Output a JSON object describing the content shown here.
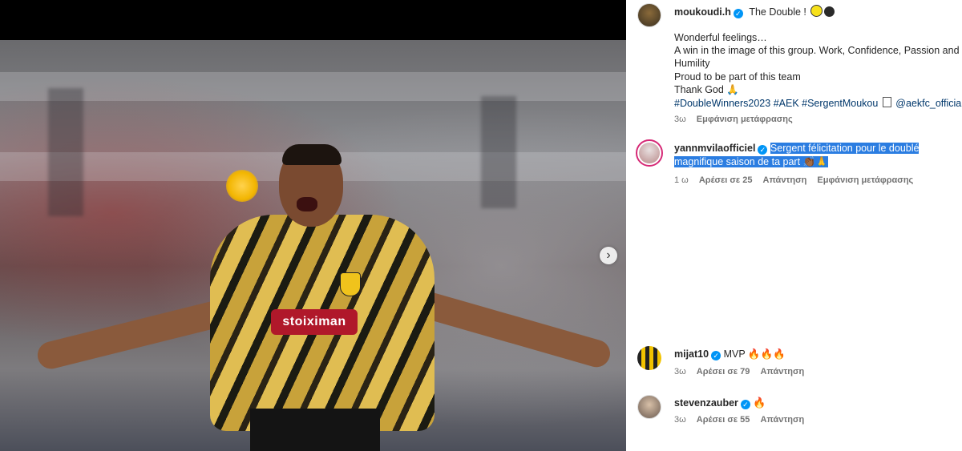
{
  "media": {
    "sponsor_text": "stoiximan",
    "next_icon": "chevron-right-icon",
    "next_glyph": "›"
  },
  "post": {
    "author": "moukoudi.h",
    "headline": "The Double !",
    "headline_emojis": [
      "yellow-circle",
      "black-circle"
    ],
    "caption_lines": [
      "Wonderful feelings…",
      "A win in the image of this group. Work, Confidence, Passion and",
      "Humility",
      "Proud to be part of this team",
      "Thank God 🙏"
    ],
    "hashtags": "#DoubleWinners2023 #AEK #SergentMoukou",
    "mention": "@aekfc_official",
    "time": "3ω",
    "see_translation": "Εμφάνιση μετάφρασης"
  },
  "comments": [
    {
      "user": "yannmvilaofficiel",
      "text_line1": "Sergent félicitation pour le doublé",
      "text_line2": "magnifique saison de ta part 👏🏾🙏",
      "time": "1 ω",
      "likes": "Αρέσει σε 25",
      "reply": "Απάντηση",
      "see_translation": "Εμφάνιση μετάφρασης"
    },
    {
      "user": "mijat10",
      "text": "MVP 🔥🔥🔥",
      "time": "3ω",
      "likes": "Αρέσει σε 79",
      "reply": "Απάντηση"
    },
    {
      "user": "stevenzauber",
      "text": "🔥",
      "time": "3ω",
      "likes": "Αρέσει σε 55",
      "reply": "Απάντηση"
    }
  ],
  "colors": {
    "verified": "#0095f6",
    "selection": "#2b7de1",
    "link": "#00376b"
  }
}
